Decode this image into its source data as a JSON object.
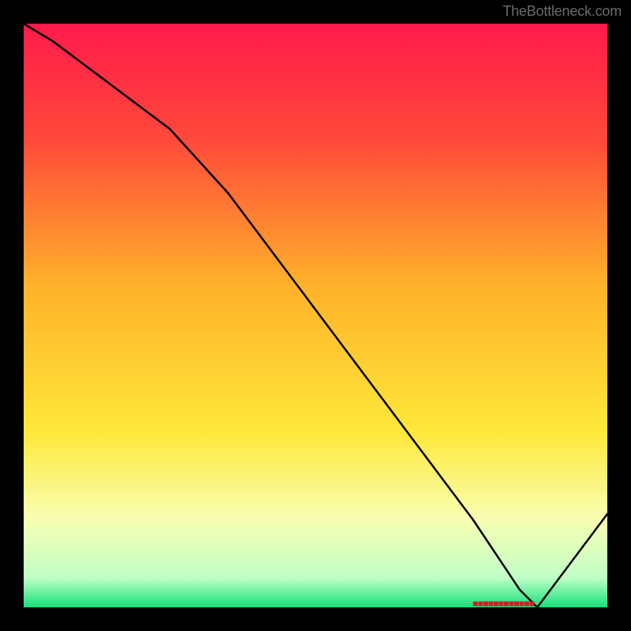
{
  "attribution": "TheBottleneck.com",
  "marker_label": "■■■■■■■■■■■■",
  "chart_data": {
    "type": "line",
    "title": "",
    "xlabel": "",
    "ylabel": "",
    "xlim": [
      0,
      100
    ],
    "ylim": [
      0,
      100
    ],
    "series": [
      {
        "name": "curve",
        "x": [
          0,
          5,
          25,
          35,
          50,
          65,
          77,
          85,
          88,
          100
        ],
        "values": [
          100,
          97,
          82,
          71,
          51,
          31,
          15,
          3,
          0,
          16
        ]
      }
    ],
    "gradient_stops": [
      {
        "y": 0,
        "color": "#ff1a4b"
      },
      {
        "y": 20,
        "color": "#ff4a3a"
      },
      {
        "y": 45,
        "color": "#ffb22a"
      },
      {
        "y": 70,
        "color": "#ffe83a"
      },
      {
        "y": 85,
        "color": "#f8ffb3"
      },
      {
        "y": 95,
        "color": "#bfffc6"
      },
      {
        "y": 100,
        "color": "#16e07a"
      }
    ],
    "marker": {
      "x_start": 77,
      "x_end": 94,
      "y": 0
    }
  }
}
